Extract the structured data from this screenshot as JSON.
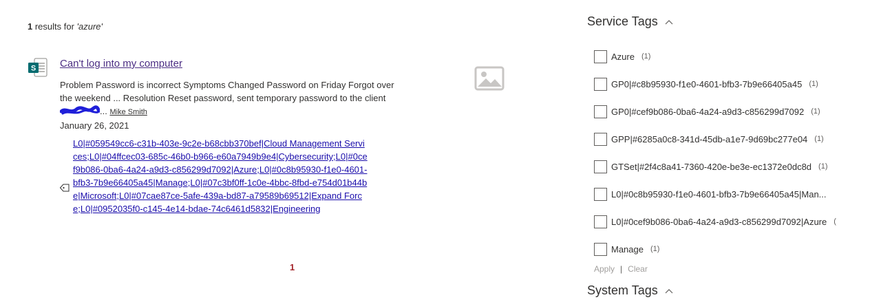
{
  "results": {
    "count": "1",
    "count_text": " results for ",
    "query": "'azure'"
  },
  "result": {
    "icon": "sharepoint-doc-icon",
    "title": "Can't log into my computer",
    "summary": "Problem Password is incorrect Symptoms Changed Password on Friday Forgot over the weekend ... Resolution Reset password, sent temporary password to the client ",
    "ellipsis": "...",
    "author": "Mike Smith",
    "date": "January 26, 2021",
    "tags": [
      {
        "text": "L0|#059549cc6-c31b-403e-9c2e-b68cbb370bef|Cloud Management Services",
        "sep": ";"
      },
      {
        "text": "L0|#04ffcec03-685c-46b0-b966-e60a7949b9e4|Cybersecurity",
        "sep": ";"
      },
      {
        "text": "L0|#0cef9b086-0ba6-4a24-a9d3-c856299d7092|Azure",
        "sep": ";"
      },
      {
        "text": "L0|#0c8b95930-f1e0-4601-bfb3-7b9e66405a45|Manage",
        "sep": ";"
      },
      {
        "text": "L0|#07c3bf0ff-1c0e-4bbc-8fbd-e754d01b44be|Microsoft",
        "sep": ";"
      },
      {
        "text": "L0|#07cae87ce-5afe-439a-bd87-a79589b69512|Expand Force",
        "sep": ";"
      },
      {
        "text": "L0|#0952035f0-c145-4e14-bdae-74c6461d5832|Engineering",
        "sep": ""
      }
    ]
  },
  "pagination": {
    "current": "1"
  },
  "refiners": {
    "service_tags": {
      "title": "Service Tags",
      "items": [
        {
          "label": "Azure",
          "count": "(1)"
        },
        {
          "label": "GP0|#c8b95930-f1e0-4601-bfb3-7b9e66405a45",
          "count": "(1)"
        },
        {
          "label": "GP0|#cef9b086-0ba6-4a24-a9d3-c856299d7092",
          "count": "(1)"
        },
        {
          "label": "GPP|#6285a0c8-341d-45db-a1e7-9d69bc277e04",
          "count": "(1)"
        },
        {
          "label": "GTSet|#2f4c8a41-7360-420e-be3e-ec1372e0dc8d",
          "count": "(1)"
        },
        {
          "label": "L0|#0c8b95930-f1e0-4601-bfb3-7b9e66405a45|Man...",
          "count": ""
        },
        {
          "label": "L0|#0cef9b086-0ba6-4a24-a9d3-c856299d7092|Azure",
          "count": "("
        },
        {
          "label": "Manage",
          "count": "(1)"
        }
      ],
      "apply": "Apply",
      "separator": "|",
      "clear": "Clear"
    },
    "system_tags": {
      "title": "System Tags"
    }
  },
  "colors": {
    "title_link": "#4b2d83",
    "tag_link": "#1a0dab",
    "page_number": "#a4262c",
    "sharepoint_teal": "#036c70"
  }
}
